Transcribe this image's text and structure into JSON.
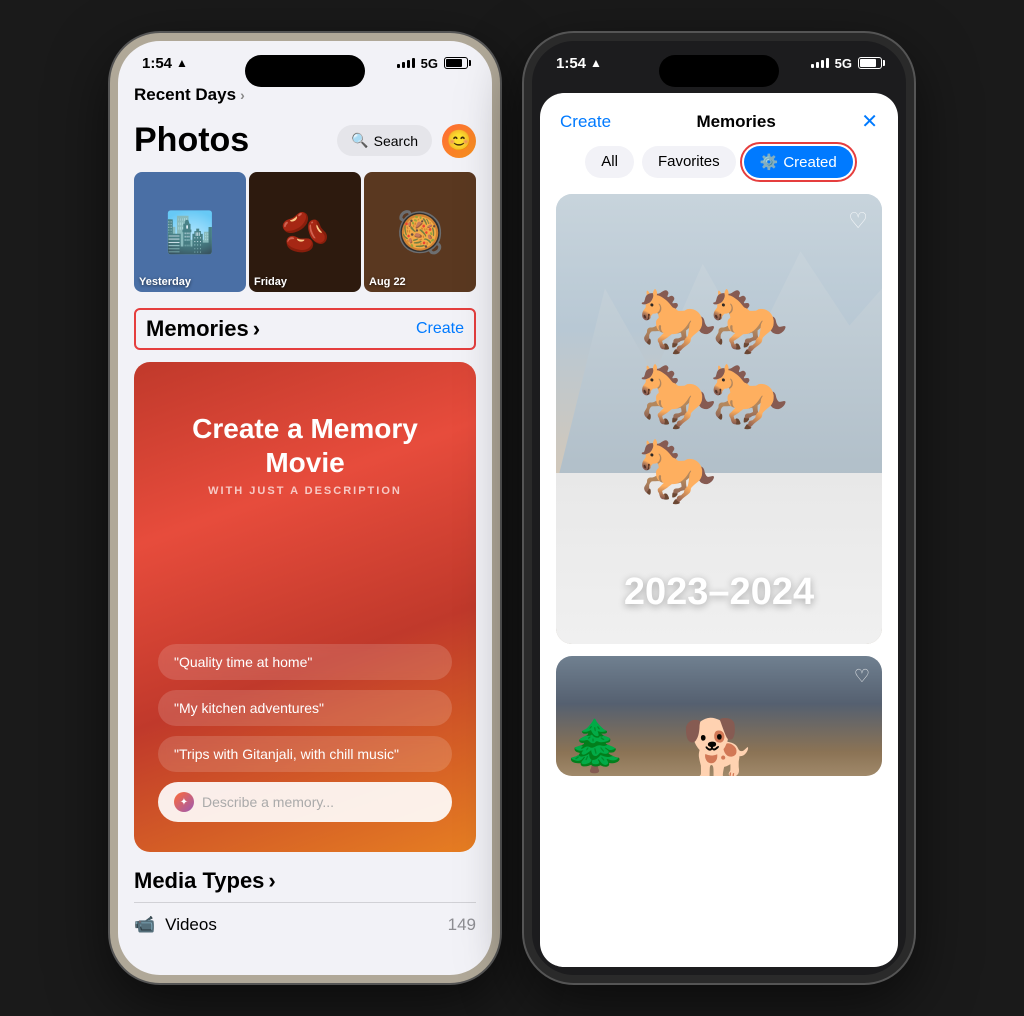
{
  "phones": {
    "left": {
      "status": {
        "time": "1:54",
        "signal": "5G",
        "battery": "80"
      },
      "header": {
        "title": "Photos",
        "search_label": "Search",
        "recent_label": "Recent Days",
        "chevron": "›"
      },
      "thumbnails": [
        {
          "label": "Yesterday",
          "emoji": "🏙️",
          "bg": "#4a6fa5"
        },
        {
          "label": "Friday",
          "emoji": "🫘",
          "bg": "#3d2b1a"
        },
        {
          "label": "Aug 22",
          "emoji": "🥘",
          "bg": "#8B4513"
        }
      ],
      "memories": {
        "title": "Memories",
        "chevron": "›",
        "create_label": "Create",
        "card": {
          "title": "Create a Memory Movie",
          "subtitle": "WITH JUST A DESCRIPTION",
          "suggestions": [
            "\"Quality time at home\"",
            "\"My kitchen adventures\"",
            "\"Trips with Gitanjali, with chill music\""
          ],
          "input_placeholder": "Describe a memory..."
        }
      },
      "media_types": {
        "title": "Media Types",
        "chevron": "›",
        "items": [
          {
            "label": "Videos",
            "icon": "📹",
            "count": "149"
          }
        ]
      }
    },
    "right": {
      "status": {
        "time": "1:54",
        "signal": "5G"
      },
      "nav": {
        "create_label": "Create",
        "title": "Memories",
        "close_label": "✕"
      },
      "filters": [
        {
          "label": "All",
          "active": false
        },
        {
          "label": "Favorites",
          "active": false
        },
        {
          "label": "Created",
          "active": true,
          "icon": "⚙️"
        }
      ],
      "main_memory": {
        "year_label": "2023–2024",
        "heart_icon": "♡"
      },
      "small_memory": {
        "heart_icon": "♡"
      }
    }
  }
}
